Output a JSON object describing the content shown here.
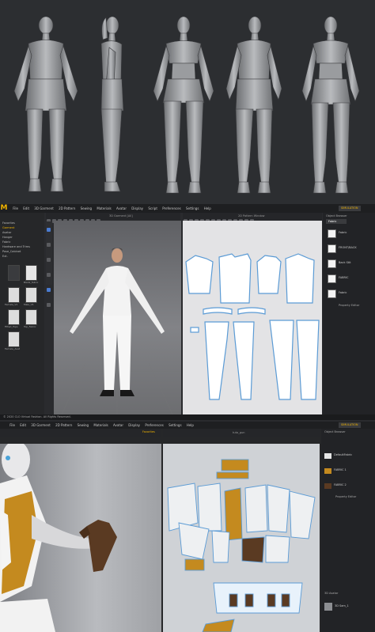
{
  "md_window": {
    "logo": "M",
    "menu": [
      "File",
      "Edit",
      "3D Garment",
      "2D Pattern",
      "Sewing",
      "Materials",
      "Avatar",
      "Display",
      "Script",
      "Preferences",
      "Settings",
      "Help"
    ],
    "simulation_badge": "SIMULATION",
    "view3d_title": "3D Garment  [All]",
    "view2d_title": "2D Pattern Window",
    "library_items": [
      "Favorites",
      "Garment",
      "Avatar",
      "Hanger",
      "Fabric",
      "Hardware and Trims",
      "Pose_Cabinet",
      "Ext."
    ],
    "thumb_labels": [
      "Blank_fabric",
      "",
      "Female_V1",
      "Male_V1",
      "Fitted_Tops",
      "Top_Fabric",
      "",
      "Female_Avat"
    ],
    "object_browser_title": "Object Browser",
    "object_browser_tab": "Fabric",
    "fabric_items": [
      "Fabric",
      "FRONT/BACK",
      "Back Stit",
      "FABRIC",
      "Fabric"
    ],
    "property_editor_title": "Property Editor",
    "status": "© 2020 CLO Virtual Fashion. All Rights Reserved."
  },
  "clo_window": {
    "menu": [
      "File",
      "Edit",
      "3D Garment",
      "2D Pattern",
      "Sewing",
      "Materials",
      "Avatar",
      "Display",
      "Preferences",
      "Settings",
      "Help"
    ],
    "simulation_badge": "SIMULATION",
    "view2d_title": "tuta_gun",
    "view3d_title": "Favorites",
    "object_browser_title": "Object Browser",
    "fabric_items": [
      "DefaultFabric",
      "FABRIC 1",
      "FABRIC 2"
    ],
    "property_editor_title": "Property Editor",
    "avatar_section_title": "3D Avatar",
    "avatar_item": "3D Sam_1"
  },
  "colors": {
    "accent": "#f0b300",
    "md_background": "#2a2b2e",
    "sculpt_background": "#2c2e31",
    "pattern_outline": "#5b9bd5",
    "ochre_fabric": "#c48a1f",
    "leather": "#5a3a22"
  }
}
